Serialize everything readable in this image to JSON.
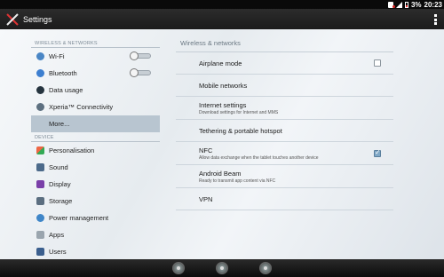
{
  "status_bar": {
    "battery_text": "3%",
    "time": "20:23"
  },
  "action_bar": {
    "title": "Settings"
  },
  "sidebar": {
    "sections": [
      {
        "header": "WIRELESS & NETWORKS",
        "items": [
          {
            "label": "Wi-Fi",
            "icon": "wifi-icon",
            "toggle": false
          },
          {
            "label": "Bluetooth",
            "icon": "bluetooth-icon",
            "toggle": false
          },
          {
            "label": "Data usage",
            "icon": "data-usage-icon"
          },
          {
            "label": "Xperia™ Connectivity",
            "icon": "xperia-connectivity-icon"
          },
          {
            "label": "More...",
            "icon": "",
            "selected": true
          }
        ]
      },
      {
        "header": "DEVICE",
        "items": [
          {
            "label": "Personalisation",
            "icon": "personalisation-icon"
          },
          {
            "label": "Sound",
            "icon": "sound-icon"
          },
          {
            "label": "Display",
            "icon": "display-icon"
          },
          {
            "label": "Storage",
            "icon": "storage-icon"
          },
          {
            "label": "Power management",
            "icon": "power-management-icon"
          },
          {
            "label": "Apps",
            "icon": "apps-icon"
          },
          {
            "label": "Users",
            "icon": "users-icon"
          }
        ]
      }
    ]
  },
  "main": {
    "title": "Wireless & networks",
    "settings": [
      {
        "title": "Airplane mode",
        "subtitle": "",
        "checkbox": true,
        "checked": false
      },
      {
        "title": "Mobile networks",
        "subtitle": ""
      },
      {
        "title": "Internet settings",
        "subtitle": "Download settings for Internet and MMS"
      },
      {
        "title": "Tethering & portable hotspot",
        "subtitle": ""
      },
      {
        "title": "NFC",
        "subtitle": "Allow data exchange when the tablet touches another device",
        "checkbox": true,
        "checked": true
      },
      {
        "title": "Android Beam",
        "subtitle": "Ready to transmit app content via NFC"
      },
      {
        "title": "VPN",
        "subtitle": ""
      }
    ]
  },
  "colors": {
    "selected_bg": "#b8c5d0",
    "accent": "#7fa7c6"
  }
}
